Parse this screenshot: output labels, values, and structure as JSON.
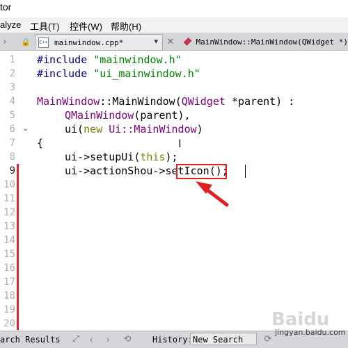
{
  "window": {
    "title_fragment": "tor"
  },
  "menu": [
    {
      "label": "alyze"
    },
    {
      "label": "工具(T)"
    },
    {
      "label": "控件(W)"
    },
    {
      "label": "帮助(H)"
    }
  ],
  "toolbar": {
    "file_tab": "mainwindow.cpp*",
    "file_icon": "C++",
    "function_label": "MainWindow::MainWindow(QWidget *)"
  },
  "editor": {
    "line_numbers": [
      "1",
      "2",
      "3",
      "4",
      "5",
      "6",
      "7",
      "8",
      "9",
      "10",
      "11",
      "12",
      "13",
      "14",
      "15",
      "16",
      "17",
      "18",
      "19",
      "20"
    ],
    "current_line": 9,
    "code": {
      "l1": {
        "pre": "#include",
        "str": "\"mainwindow.h\""
      },
      "l2": {
        "pre": "#include",
        "str": "\"ui_mainwindow.h\""
      },
      "l4": {
        "cls": "MainWindow",
        "sep": "::",
        "fn": "MainWindow",
        "open": "(",
        "typ": "QWidget",
        "rest": " *parent) :"
      },
      "l5": {
        "typ": "QMainWindow",
        "rest": "(parent),"
      },
      "l6": {
        "a": "ui(",
        "kw": "new",
        "b": " ",
        "typ": "Ui::MainWindow",
        "c": ")"
      },
      "l7": "{",
      "l8": {
        "a": "ui->setupUi(",
        "kw": "this",
        "b": ");"
      },
      "l9": {
        "a": "ui->actionShou->",
        "b": "setIcon",
        "c": "();"
      }
    }
  },
  "bottom": {
    "search_results": "arch Results",
    "history_label": "History:",
    "history_value": "New Search"
  },
  "watermark": {
    "text": "jingyan.baidu.com",
    "logo": "Baidu"
  },
  "colors": {
    "annotation": "#e02020",
    "change_bar": "#d9252b"
  }
}
